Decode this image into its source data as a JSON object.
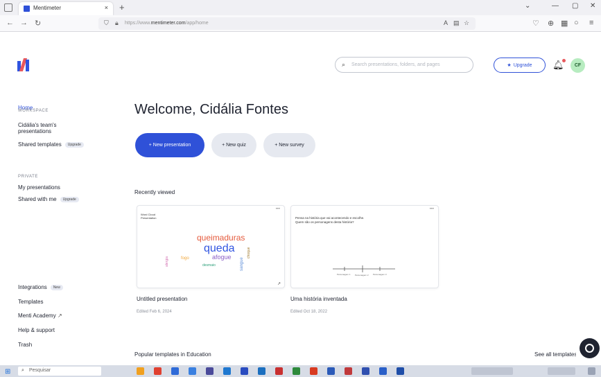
{
  "browser": {
    "tab_title": "Mentimeter",
    "tab_close": "×",
    "new_tab": "+",
    "url_prefix": "https://www.",
    "url_domain": "mentimeter.com",
    "url_path": "/app/home",
    "window_controls": [
      "⌄",
      "—",
      "▢",
      "✕"
    ]
  },
  "search": {
    "placeholder": "Search presentations, folders, and pages"
  },
  "header": {
    "upgrade_label": "Upgrade",
    "avatar_initials": "CF"
  },
  "sidebar": {
    "home": "Home",
    "workspace_heading": "WORKSPACE",
    "workspace_item_line1": "Cidália's team's",
    "workspace_item_line2": "presentations",
    "shared_templates": "Shared templates",
    "shared_templates_pill": "Upgrade",
    "private_heading": "PRIVATE",
    "my_presentations": "My presentations",
    "shared_with_me": "Shared with me",
    "shared_with_me_pill": "Upgrade",
    "integrations": "Integrations",
    "integrations_pill": "New",
    "templates": "Templates",
    "menti_academy": "Menti Academy",
    "help_support": "Help & support",
    "trash": "Trash"
  },
  "main": {
    "welcome": "Welcome, Cidália Fontes",
    "new_presentation": "+ New presentation",
    "new_quiz": "+ New quiz",
    "new_survey": "+ New survey",
    "recently_viewed": "Recently viewed",
    "popular_templates": "Popular templates in Education",
    "see_all_templates": "See all templates"
  },
  "cards": [
    {
      "title": "Untitled presentation",
      "meta": "Edited Feb 6, 2024",
      "thumb_header_line1": "Word Cloud",
      "thumb_header_line2": "Presentation",
      "words": [
        "queimaduras",
        "queda",
        "afogue",
        "fogo",
        "desmaio",
        "alergia",
        "sangue",
        "choque"
      ],
      "word_colors": [
        "#e55a3c",
        "#3054e0",
        "#8b5fc7",
        "#f0a63a",
        "#2ea07a",
        "#d26db0",
        "#5f8fd8",
        "#a07a2e"
      ],
      "corner_mark": "↗"
    },
    {
      "title": "Uma história inventada",
      "meta": "Edited Oct 18, 2022",
      "thumb_text_line1": "Pensa na história que vai acontecendo e escolhe.",
      "thumb_text_line2": "Quem são os personagens desta história?",
      "node_labels": [
        "Personagem 1",
        "Personagem 2",
        "Personagem 3"
      ]
    }
  ],
  "taskbar": {
    "search_placeholder": "Pesquisar",
    "start_icon": "windows-logo"
  }
}
